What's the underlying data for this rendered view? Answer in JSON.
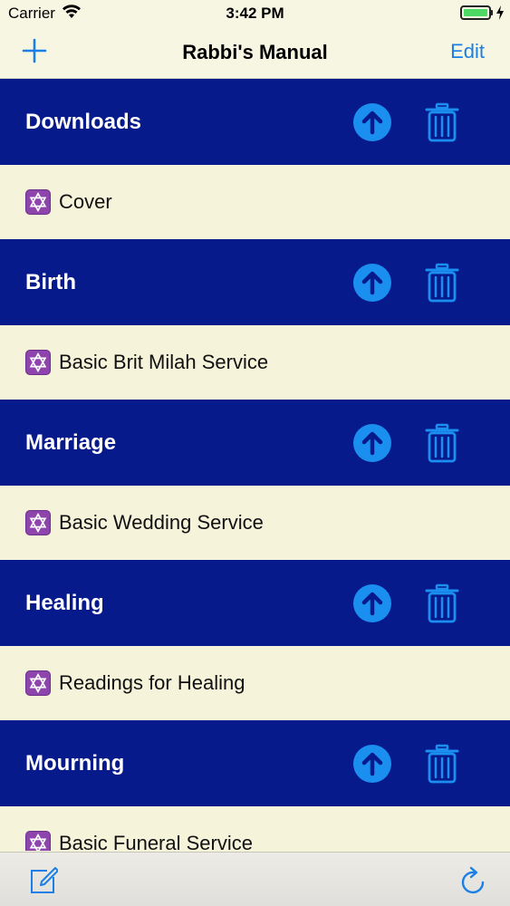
{
  "status": {
    "carrier": "Carrier",
    "time": "3:42 PM",
    "wifi_icon": "wifi-icon",
    "battery_icon": "battery-icon"
  },
  "nav": {
    "title": "Rabbi's Manual",
    "edit_label": "Edit",
    "add_icon": "plus-icon"
  },
  "colors": {
    "accent": "#1a7fe6",
    "section_bg": "#061a8c",
    "row_bg": "#f5f3da",
    "icon_blue": "#1a8ff0"
  },
  "sections": [
    {
      "title": "Downloads",
      "items": [
        {
          "label": "Cover",
          "icon": "star-of-david-icon"
        }
      ]
    },
    {
      "title": "Birth",
      "items": [
        {
          "label": "Basic Brit Milah Service",
          "icon": "star-of-david-icon"
        }
      ]
    },
    {
      "title": "Marriage",
      "items": [
        {
          "label": "Basic Wedding Service",
          "icon": "star-of-david-icon"
        }
      ]
    },
    {
      "title": "Healing",
      "items": [
        {
          "label": "Readings for Healing",
          "icon": "star-of-david-icon"
        }
      ]
    },
    {
      "title": "Mourning",
      "items": [
        {
          "label": "Basic Funeral Service",
          "icon": "star-of-david-icon"
        }
      ]
    }
  ],
  "toolbar": {
    "compose_icon": "compose-icon",
    "refresh_icon": "refresh-icon"
  }
}
